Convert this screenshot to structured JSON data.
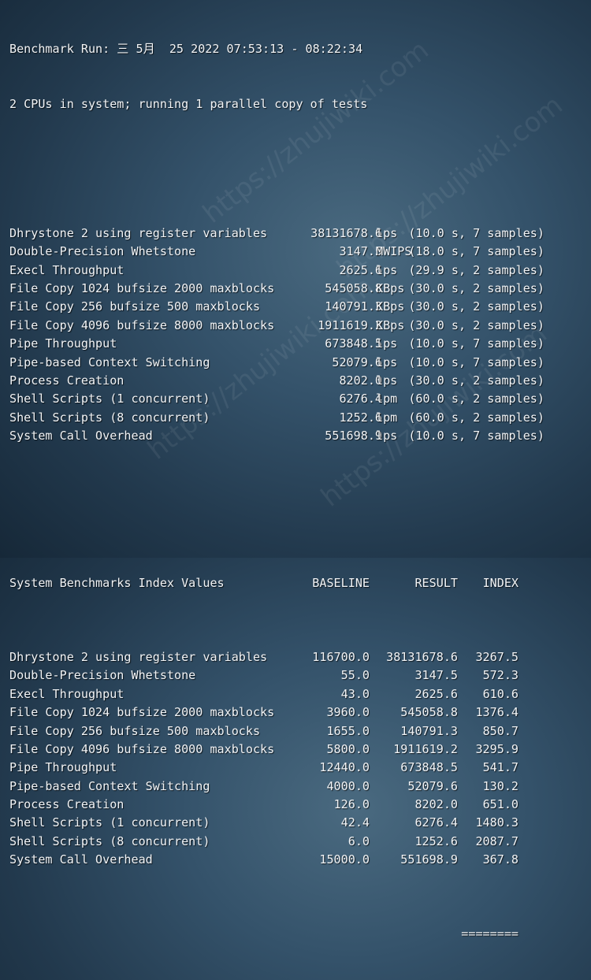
{
  "header": {
    "run_line": "Benchmark Run: 三 5月  25 2022 07:53:13 - 08:22:34",
    "cpu_line": "2 CPUs in system; running 1 parallel copy of tests"
  },
  "results": [
    {
      "name": "Dhrystone 2 using register variables",
      "value": "38131678.6",
      "unit": "lps",
      "timing": "(10.0 s, 7 samples)"
    },
    {
      "name": "Double-Precision Whetstone",
      "value": "3147.5",
      "unit": "MWIPS",
      "timing": "(18.0 s, 7 samples)"
    },
    {
      "name": "Execl Throughput",
      "value": "2625.6",
      "unit": "lps",
      "timing": "(29.9 s, 2 samples)"
    },
    {
      "name": "File Copy 1024 bufsize 2000 maxblocks",
      "value": "545058.8",
      "unit": "KBps",
      "timing": "(30.0 s, 2 samples)"
    },
    {
      "name": "File Copy 256 bufsize 500 maxblocks",
      "value": "140791.3",
      "unit": "KBps",
      "timing": "(30.0 s, 2 samples)"
    },
    {
      "name": "File Copy 4096 bufsize 8000 maxblocks",
      "value": "1911619.2",
      "unit": "KBps",
      "timing": "(30.0 s, 2 samples)"
    },
    {
      "name": "Pipe Throughput",
      "value": "673848.5",
      "unit": "lps",
      "timing": "(10.0 s, 7 samples)"
    },
    {
      "name": "Pipe-based Context Switching",
      "value": "52079.6",
      "unit": "lps",
      "timing": "(10.0 s, 7 samples)"
    },
    {
      "name": "Process Creation",
      "value": "8202.0",
      "unit": "lps",
      "timing": "(30.0 s, 2 samples)"
    },
    {
      "name": "Shell Scripts (1 concurrent)",
      "value": "6276.4",
      "unit": "lpm",
      "timing": "(60.0 s, 2 samples)"
    },
    {
      "name": "Shell Scripts (8 concurrent)",
      "value": "1252.6",
      "unit": "lpm",
      "timing": "(60.0 s, 2 samples)"
    },
    {
      "name": "System Call Overhead",
      "value": "551698.9",
      "unit": "lps",
      "timing": "(10.0 s, 7 samples)"
    }
  ],
  "index_table": {
    "title": "System Benchmarks Index Values",
    "col_baseline": "BASELINE",
    "col_result": "RESULT",
    "col_index": "INDEX",
    "rows": [
      {
        "name": "Dhrystone 2 using register variables",
        "baseline": "116700.0",
        "result": "38131678.6",
        "index": "3267.5"
      },
      {
        "name": "Double-Precision Whetstone",
        "baseline": "55.0",
        "result": "3147.5",
        "index": "572.3"
      },
      {
        "name": "Execl Throughput",
        "baseline": "43.0",
        "result": "2625.6",
        "index": "610.6"
      },
      {
        "name": "File Copy 1024 bufsize 2000 maxblocks",
        "baseline": "3960.0",
        "result": "545058.8",
        "index": "1376.4"
      },
      {
        "name": "File Copy 256 bufsize 500 maxblocks",
        "baseline": "1655.0",
        "result": "140791.3",
        "index": "850.7"
      },
      {
        "name": "File Copy 4096 bufsize 8000 maxblocks",
        "baseline": "5800.0",
        "result": "1911619.2",
        "index": "3295.9"
      },
      {
        "name": "Pipe Throughput",
        "baseline": "12440.0",
        "result": "673848.5",
        "index": "541.7"
      },
      {
        "name": "Pipe-based Context Switching",
        "baseline": "4000.0",
        "result": "52079.6",
        "index": "130.2"
      },
      {
        "name": "Process Creation",
        "baseline": "126.0",
        "result": "8202.0",
        "index": "651.0"
      },
      {
        "name": "Shell Scripts (1 concurrent)",
        "baseline": "42.4",
        "result": "6276.4",
        "index": "1480.3"
      },
      {
        "name": "Shell Scripts (8 concurrent)",
        "baseline": "6.0",
        "result": "1252.6",
        "index": "2087.7"
      },
      {
        "name": "System Call Overhead",
        "baseline": "15000.0",
        "result": "551698.9",
        "index": "367.8"
      }
    ],
    "separator": "========"
  },
  "watermark": {
    "text": "https://zhujiwiki.com"
  }
}
